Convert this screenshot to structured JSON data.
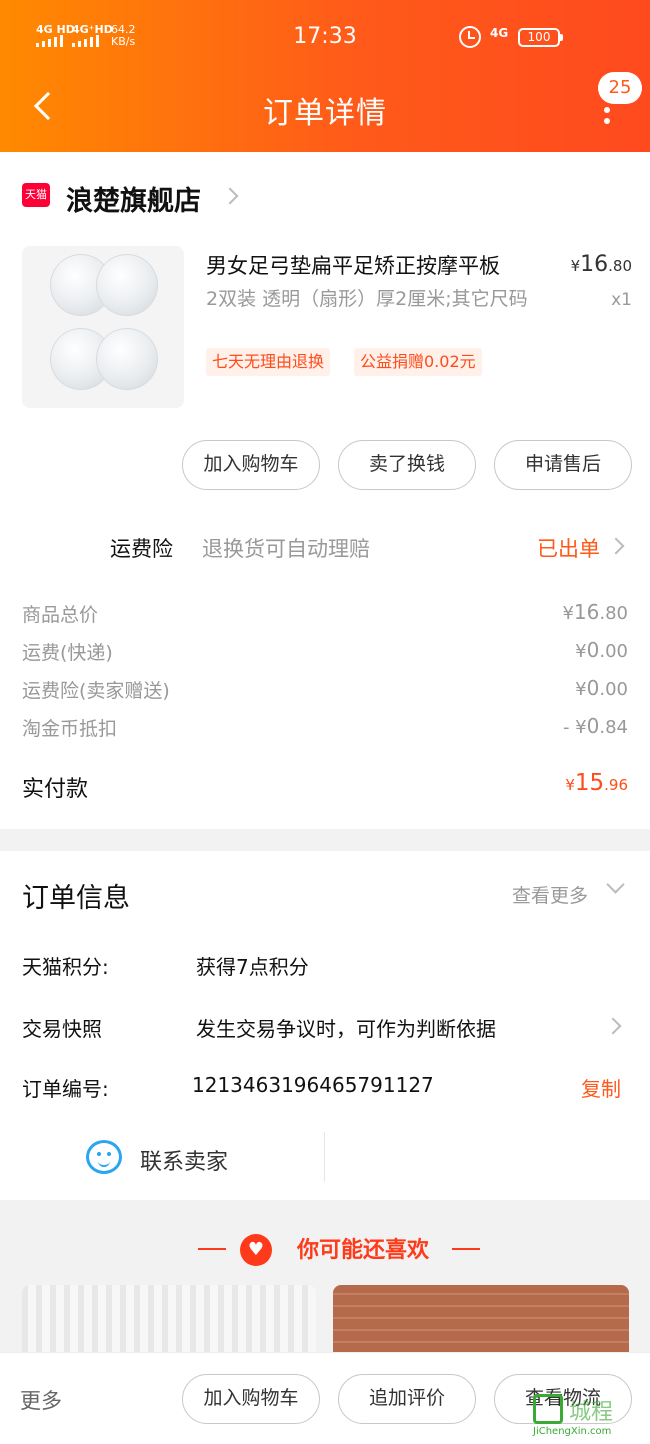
{
  "status_bar": {
    "sim1": "4G HD",
    "sim2": "4G⁺HD",
    "net_speed_value": "64.2",
    "net_speed_unit": "KB/s",
    "time": "17:33",
    "network": "4G",
    "battery": "100"
  },
  "header": {
    "title": "订单详情",
    "message_count": "25",
    "back_icon": "chevron-left-icon",
    "more_icon": "vertical-dots-icon"
  },
  "store": {
    "badge": "天猫",
    "name": "浪楚旗舰店"
  },
  "product": {
    "name": "男女足弓垫扁平足矫正按摩平板",
    "spec": "2双装 透明（扇形）厚2厘米;其它尺码",
    "price_symbol": "¥",
    "price_int": "16",
    "price_dec": ".80",
    "quantity": "x1",
    "tags": [
      "七天无理由退换",
      "公益捐赠0.02元"
    ]
  },
  "product_actions": [
    "加入购物车",
    "卖了换钱",
    "申请售后"
  ],
  "insurance": {
    "label": "运费险",
    "desc": "退换货可自动理赔",
    "status": "已出单"
  },
  "costs": [
    {
      "label": "商品总价",
      "sym": "¥",
      "int": "16",
      "dec": ".80"
    },
    {
      "label": "运费(快递)",
      "sym": "¥",
      "int": "0",
      "dec": ".00"
    },
    {
      "label": "运费险(卖家赠送)",
      "sym": "¥",
      "int": "0",
      "dec": ".00"
    },
    {
      "label": "淘金币抵扣",
      "sym": "- ¥",
      "int": "0",
      "dec": ".84"
    }
  ],
  "paid": {
    "label": "实付款",
    "sym": "¥",
    "int": "15",
    "dec": ".96"
  },
  "order_info": {
    "title": "订单信息",
    "more": "查看更多",
    "points_label": "天猫积分:",
    "points_value": "获得7点积分",
    "snapshot_label": "交易快照",
    "snapshot_value": "发生交易争议时，可作为判断依据",
    "order_no_label": "订单编号:",
    "order_no_value": "1213463196465791127",
    "copy": "复制"
  },
  "contact": {
    "label": "联系卖家"
  },
  "recommend": {
    "title": "你可能还喜欢"
  },
  "bottom_bar": {
    "more": "更多",
    "buttons": [
      "加入购物车",
      "追加评价",
      "查看物流"
    ]
  },
  "watermark": {
    "text": "城程",
    "sub": "JiChengXin.com"
  }
}
